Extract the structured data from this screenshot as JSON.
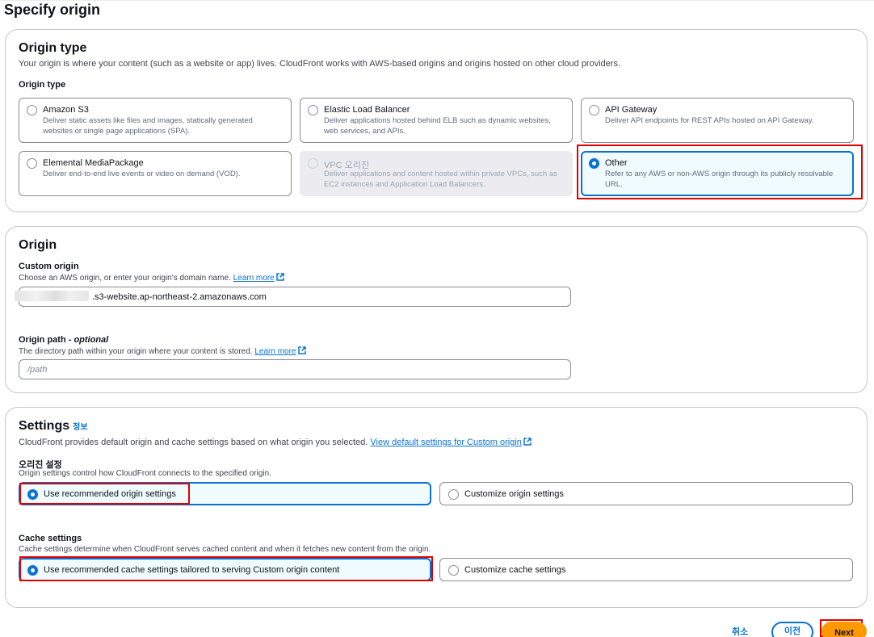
{
  "page": {
    "title": "Specify origin"
  },
  "origin_type_section": {
    "title": "Origin type",
    "description": "Your origin is where your content (such as a website or app) lives. CloudFront works with AWS-based origins and origins hosted on other cloud providers.",
    "field_label": "Origin type",
    "options": [
      {
        "title": "Amazon S3",
        "description": "Deliver static assets like files and images, statically generated websites or single page applications (SPA)."
      },
      {
        "title": "Elastic Load Balancer",
        "description": "Deliver applications hosted behind ELB such as dynamic websites, web services, and APIs."
      },
      {
        "title": "API Gateway",
        "description": "Deliver API endpoints for REST APIs hosted on API Gateway."
      },
      {
        "title": "Elemental MediaPackage",
        "description": "Deliver end-to-end live events or video on demand (VOD)."
      },
      {
        "title": "VPC 오리진",
        "description": "Deliver applications and content hosted within private VPCs, such as EC2 instances and Application Load Balancers."
      },
      {
        "title": "Other",
        "description": "Refer to any AWS or non-AWS origin through its publicly resolvable URL."
      }
    ]
  },
  "origin_section": {
    "title": "Origin",
    "custom_origin_label": "Custom origin",
    "custom_origin_hint": "Choose an AWS origin, or enter your origin's domain name.",
    "learn_more": "Learn more",
    "custom_origin_value": ".s3-website.ap-northeast-2.amazonaws.com",
    "origin_path_label": "Origin path",
    "origin_path_optional": " - optional",
    "origin_path_hint": "The directory path within your origin where your content is stored.",
    "origin_path_placeholder": "/path"
  },
  "settings_section": {
    "title": "Settings",
    "info": "정보",
    "description": "CloudFront provides default origin and cache settings based on what origin you selected.",
    "view_defaults_link": "View default settings for Custom origin",
    "origin_settings_label": "오리진 설정",
    "origin_settings_hint": "Origin settings control how CloudFront connects to the specified origin.",
    "origin_option_recommended": "Use recommended origin settings",
    "origin_option_custom": "Customize origin settings",
    "cache_settings_label": "Cache settings",
    "cache_settings_hint": "Cache settings determine when CloudFront serves cached content and when it fetches new content from the origin.",
    "cache_option_recommended": "Use recommended cache settings tailored to serving Custom origin content",
    "cache_option_custom": "Customize cache settings"
  },
  "footer": {
    "cancel": "취소",
    "previous": "이전",
    "next": "Next"
  },
  "colors": {
    "accent": "#0972d3",
    "primary_button": "#ff9900",
    "highlight": "#e00000"
  }
}
